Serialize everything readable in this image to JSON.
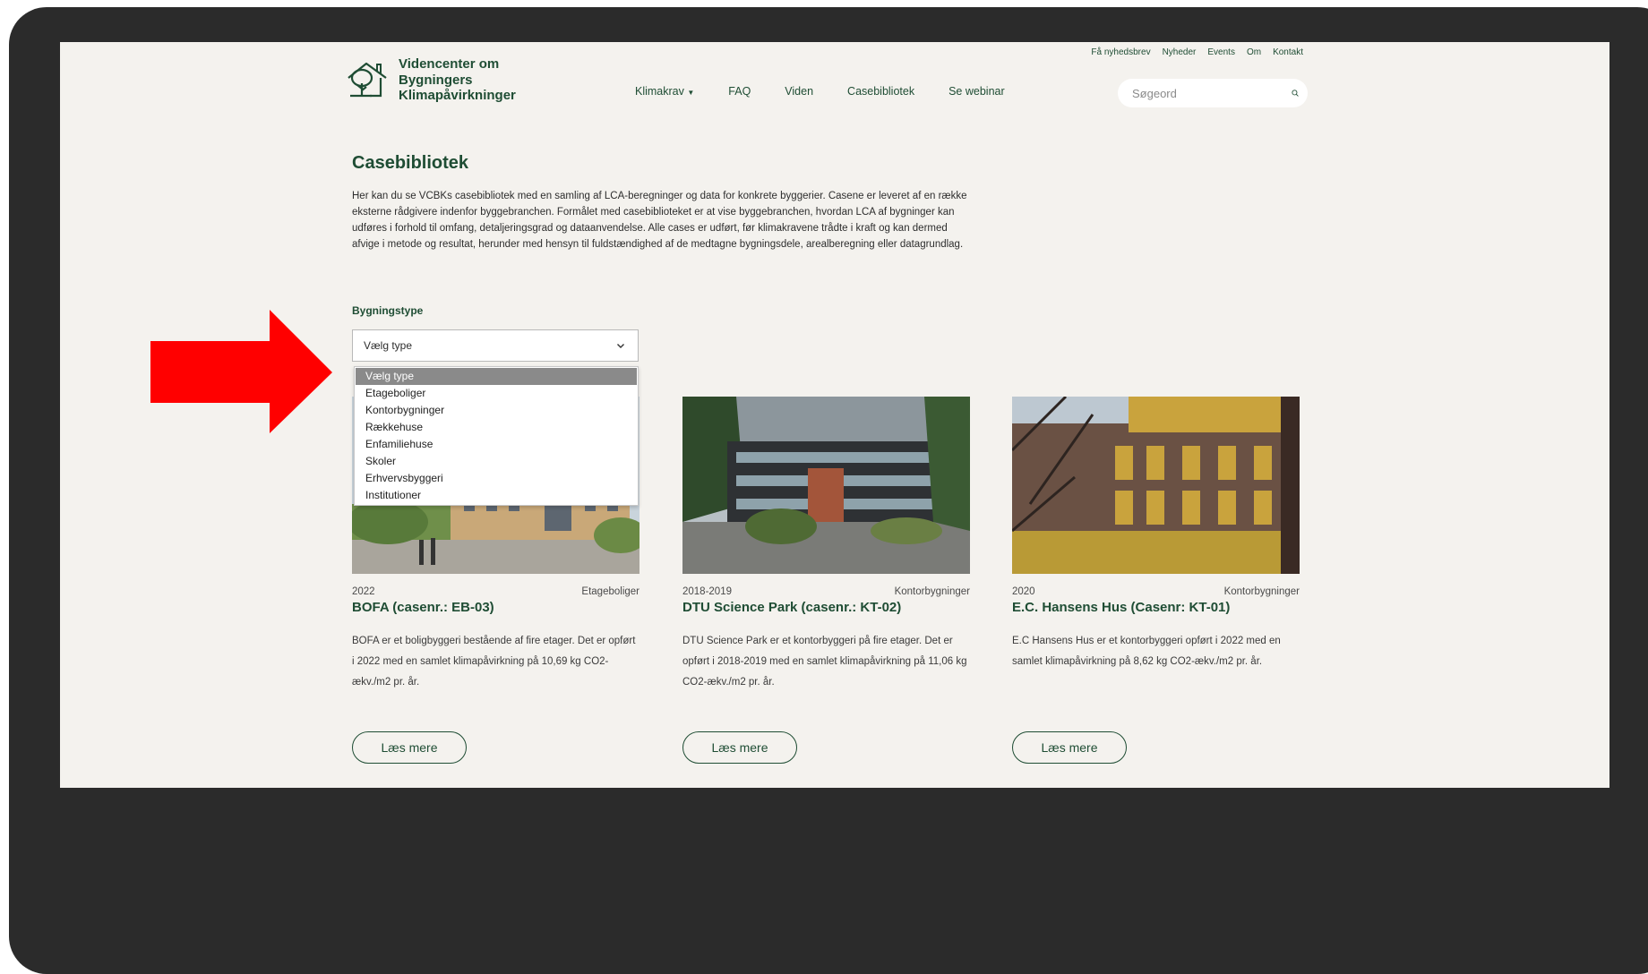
{
  "site": {
    "logo_text": "Videncenter om Bygningers Klimapåvirkninger"
  },
  "topnav": [
    "Få nyhedsbrev",
    "Nyheder",
    "Events",
    "Om",
    "Kontakt"
  ],
  "mainnav": {
    "klimakrav": "Klimakrav",
    "faq": "FAQ",
    "viden": "Viden",
    "casebibliotek": "Casebibliotek",
    "webinar": "Se webinar"
  },
  "search": {
    "placeholder": "Søgeord"
  },
  "page": {
    "title": "Casebibliotek",
    "intro": "Her kan du se VCBKs casebibliotek med en samling af LCA-beregninger og data for konkrete byggerier. Casene er leveret af en række eksterne rådgivere indenfor byggebranchen. Formålet med casebiblioteket er at vise byggebranchen, hvordan LCA af bygninger kan udføres i forhold til omfang, detaljeringsgrad og dataanvendelse. Alle cases er udført, før klimakravene trådte i kraft og kan dermed afvige i metode og resultat, herunder med hensyn til fuldstændighed af de medtagne bygningsdele, arealberegning eller datagrundlag."
  },
  "filter": {
    "label": "Bygningstype",
    "selected": "Vælg type",
    "options": [
      "Vælg type",
      "Etageboliger",
      "Kontorbygninger",
      "Rækkehuse",
      "Enfamiliehuse",
      "Skoler",
      "Erhvervsbyggeri",
      "Institutioner"
    ]
  },
  "cards": [
    {
      "year": "2022",
      "category": "Etageboliger",
      "title": "BOFA (casenr.: EB-03)",
      "desc": "BOFA er et boligbyggeri bestående af fire etager. Det er opført i 2022 med en samlet klimapåvirkning på 10,69 kg CO2-ækv./m2 pr. år.",
      "button": "Læs mere"
    },
    {
      "year": "2018-2019",
      "category": "Kontorbygninger",
      "title": "DTU Science Park (casenr.: KT-02)",
      "desc": "DTU Science Park er et kontorbyggeri på fire etager. Det er opført i 2018-2019 med en samlet klimapåvirkning på 11,06 kg CO2-ækv./m2 pr. år.",
      "button": "Læs mere"
    },
    {
      "year": "2020",
      "category": "Kontorbygninger",
      "title": "E.C. Hansens Hus (Casenr: KT-01)",
      "desc": "E.C Hansens Hus er et kontorbyggeri opført i 2022 med en samlet klimapåvirkning på 8,62 kg CO2-ækv./m2 pr. år.",
      "button": "Læs mere"
    }
  ],
  "colors": {
    "brand_green": "#1f4d34",
    "page_bg": "#f4f2ee",
    "device_frame": "#2b2b2b",
    "annotation_arrow": "#ff0000"
  }
}
